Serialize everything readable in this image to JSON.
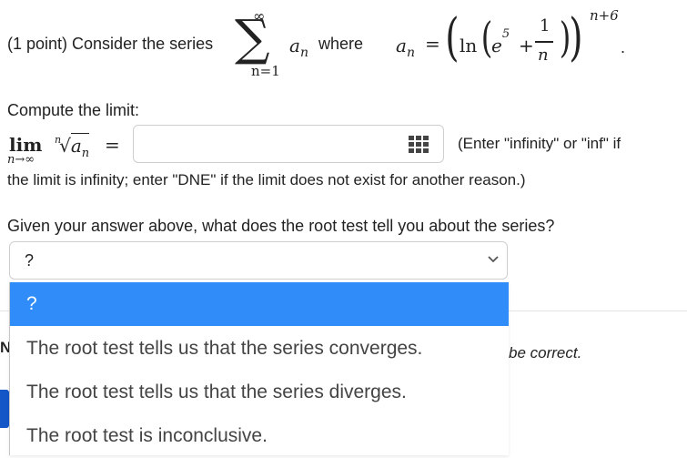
{
  "problem": {
    "intro": "(1 point) Consider the series",
    "sum_upper": "∞",
    "sum_lower": "n=1",
    "term": "a",
    "term_sub": "n",
    "where": "where",
    "an_label": "a",
    "an_sub": "n",
    "eq": "=",
    "ln": "ln",
    "e_base": "e",
    "e_exp": "5",
    "plus": "+",
    "frac_num": "1",
    "frac_den": "n",
    "exponent": "n+6",
    "period": "."
  },
  "limit_section": {
    "compute_label": "Compute the limit:",
    "lim": "lim",
    "lim_sub": "n→∞",
    "root_index": "n",
    "root_term": "a",
    "root_term_sub": "n",
    "eq": "=",
    "answer_value": "",
    "hint": "(Enter \"infinity\" or \"inf\" if",
    "hint_cont": "the limit is infinity; enter \"DNE\" if the limit does not exist for another reason.)"
  },
  "root_test": {
    "question": "Given your answer above, what does the root test tell you about the series?",
    "selected": "?",
    "options": [
      "?",
      "The root test tells us that the series converges.",
      "The root test tells us that the series diverges.",
      "The root test is inconclusive."
    ],
    "selected_index": 0
  },
  "background": {
    "partial_text": "be correct.",
    "partial_letter": "N"
  },
  "colors": {
    "highlight": "#2f8cf8",
    "button_blue": "#1356c8"
  }
}
